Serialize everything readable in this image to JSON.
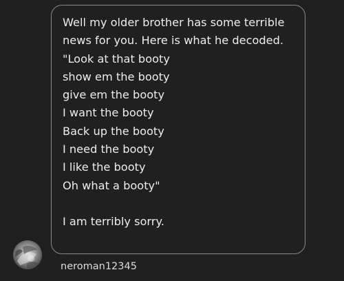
{
  "message": {
    "lines": [
      "Well my older brother has some terrible",
      "news for you. Here is what he decoded.",
      "\"Look at that booty",
      "show em the booty",
      "give em the booty",
      "I want the booty",
      "Back up the booty",
      "I need the booty",
      "I like the booty",
      "Oh what a booty\"",
      "",
      "I am terribly sorry."
    ]
  },
  "sender": {
    "username": "neroman12345",
    "avatar_icon": "user-avatar-icon"
  },
  "colors": {
    "background": "#202020",
    "bubble_border": "#8a8a8a",
    "text": "#ededed",
    "username": "#dcdcdc"
  }
}
